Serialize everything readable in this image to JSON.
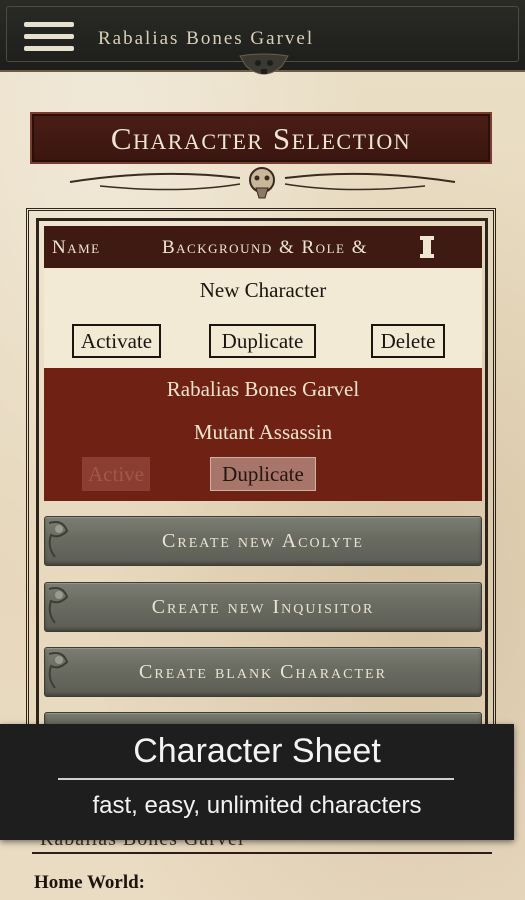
{
  "topbar": {
    "title": "Rabalias Bones Garvel"
  },
  "banner": {
    "title": "Character Selection"
  },
  "table": {
    "headers": {
      "name": "Name",
      "background_role": "Background & Role &"
    },
    "rows": [
      {
        "name": "New Character",
        "buttons": [
          "Activate",
          "Duplicate",
          "Delete"
        ]
      },
      {
        "name": "Rabalias Bones Garvel",
        "role": "Mutant Assassin",
        "buttons": [
          "Active",
          "Duplicate"
        ]
      }
    ]
  },
  "actions": [
    "Create new Acolyte",
    "Create new Inquisitor",
    "Create blank Character"
  ],
  "overlay": {
    "title": "Character Sheet",
    "subtitle": "fast, easy, unlimited characters"
  },
  "background_sheet": {
    "name": "Rabalias Bones Garvel",
    "home_world_label": "Home World:"
  },
  "colors": {
    "header_dark": "#3e1a13",
    "active_row": "#6f2114",
    "parchment": "#eadfc6",
    "stone": "#6b6c62"
  }
}
